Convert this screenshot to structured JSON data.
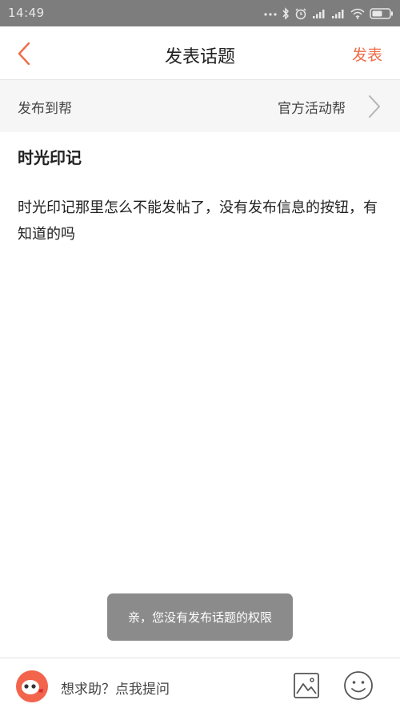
{
  "status_bar": {
    "time": "14:49",
    "icons": [
      "more-dots-icon",
      "bluetooth-icon",
      "alarm-icon",
      "signal-icon",
      "signal-icon",
      "wifi-icon",
      "battery-icon"
    ]
  },
  "header": {
    "title": "发表话题",
    "publish_label": "发表",
    "accent_color": "#ef6d4a"
  },
  "board": {
    "label": "发布到帮",
    "value": "官方活动帮"
  },
  "post": {
    "title": "时光印记",
    "body": "时光印记那里怎么不能发帖了，没有发布信息的按钮，有知道的吗"
  },
  "toast": {
    "message": "亲，您没有发布话题的权限"
  },
  "bottom_bar": {
    "ask_prompt": "想求助？点我提问",
    "avatar_color": "#f2644b"
  }
}
